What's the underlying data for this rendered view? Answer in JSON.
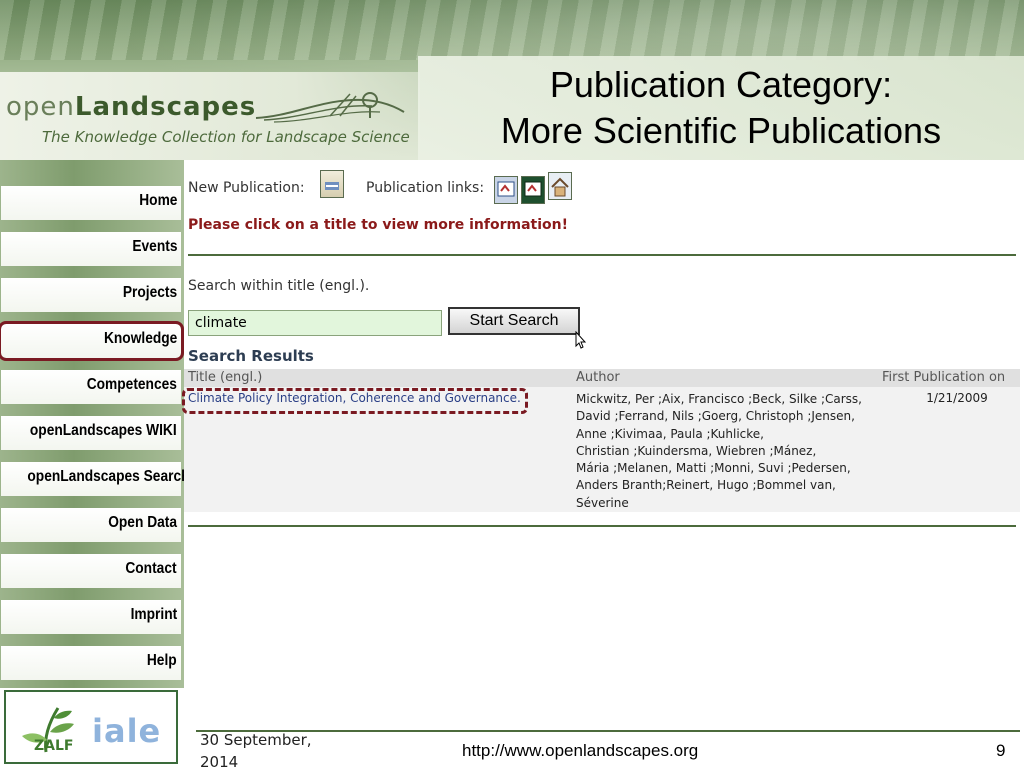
{
  "header": {
    "brand_light": "open",
    "brand_bold": "Landscapes",
    "tagline": "The Knowledge Collection for Landscape Science",
    "slide_title_line1": "Publication Category:",
    "slide_title_line2": "More Scientific Publications"
  },
  "nav": {
    "items": [
      {
        "label": "Home"
      },
      {
        "label": "Events"
      },
      {
        "label": "Projects"
      },
      {
        "label": "Knowledge",
        "active": true
      },
      {
        "label": "Competences"
      },
      {
        "label": "openLandscapes WIKI"
      },
      {
        "label": "openLandscapes Search"
      },
      {
        "label": "Open Data"
      },
      {
        "label": "Contact"
      },
      {
        "label": "Imprint"
      },
      {
        "label": "Help"
      }
    ],
    "partner_logo": "iale"
  },
  "toolbar": {
    "new_publication_label": "New Publication:",
    "publication_links_label": "Publication links:",
    "icons": [
      "new-document-icon",
      "link-icon",
      "link-dark-icon",
      "home-icon"
    ]
  },
  "message": "Please click on a title to view more information!",
  "search": {
    "label": "Search within title (engl.).",
    "value": "climate",
    "button_label": "Start Search"
  },
  "results": {
    "heading": "Search Results",
    "columns": [
      "Title (engl.)",
      "Author",
      "First Publication on"
    ],
    "rows": [
      {
        "title": "Climate Policy Integration, Coherence and Governance.",
        "authors_lines": [
          "Mickwitz, Per ;Aix, Francisco ;Beck, Silke ;Carss,",
          "David ;Ferrand, Nils ;Goerg, Christoph ;Jensen,",
          "Anne ;Kivimaa, Paula ;Kuhlicke,",
          "Christian ;Kuindersma, Wiebren ;Mánez,",
          "Mária ;Melanen, Matti ;Monni, Suvi ;Pedersen,",
          "Anders Branth;Reinert, Hugo ;Bommel van,",
          "Séverine"
        ],
        "date": "1/21/2009"
      }
    ]
  },
  "footer": {
    "date_line1": "30 September,",
    "date_line2": "2014",
    "url": "http://www.openlandscapes.org",
    "page_number": "9"
  },
  "colors": {
    "accent_green": "#4c6b3c",
    "highlight_red": "#7a1a22",
    "message_red": "#8b1a1a",
    "link_blue": "#2a3f86"
  }
}
